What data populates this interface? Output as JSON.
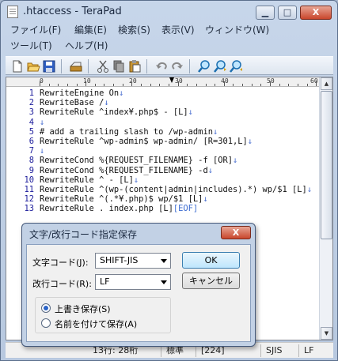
{
  "window": {
    "title": ".htaccess - TeraPad",
    "controls": {
      "minimize": "▁",
      "maximize": "□",
      "close": "X"
    }
  },
  "menu": [
    {
      "label": "ファイル(F)"
    },
    {
      "label": "編集(E)"
    },
    {
      "label": "検索(S)"
    },
    {
      "label": "表示(V)"
    },
    {
      "label": "ウィンドウ(W)"
    },
    {
      "label": "ツール(T)"
    },
    {
      "label": "ヘルプ(H)"
    }
  ],
  "toolbar": {
    "buttons": [
      {
        "icon": "new-file-icon"
      },
      {
        "icon": "open-folder-icon"
      },
      {
        "icon": "save-icon"
      },
      {
        "icon": "print-icon"
      },
      {
        "icon": "cut-icon"
      },
      {
        "icon": "copy-icon"
      },
      {
        "icon": "paste-icon"
      },
      {
        "icon": "undo-icon"
      },
      {
        "icon": "redo-icon"
      },
      {
        "icon": "find-icon"
      },
      {
        "icon": "find-next-icon"
      },
      {
        "icon": "find-previous-icon"
      }
    ]
  },
  "ruler": {
    "labels": [
      "0",
      "10",
      "20",
      "30",
      "40",
      "50",
      "60"
    ]
  },
  "editor": {
    "lines": [
      {
        "num": "1",
        "text": "RewriteEngine On",
        "ret": "↓"
      },
      {
        "num": "2",
        "text": "RewriteBase /",
        "ret": "↓"
      },
      {
        "num": "3",
        "text": "RewriteRule ^index¥.php$ - [L]",
        "ret": "↓"
      },
      {
        "num": "4",
        "text": "",
        "ret": "↓"
      },
      {
        "num": "5",
        "text": "# add a trailing slash to /wp-admin",
        "ret": "↓"
      },
      {
        "num": "6",
        "text": "RewriteRule ^wp-admin$ wp-admin/ [R=301,L]",
        "ret": "↓"
      },
      {
        "num": "7",
        "text": "",
        "ret": "↓"
      },
      {
        "num": "8",
        "text": "RewriteCond %{REQUEST_FILENAME} -f [OR]",
        "ret": "↓"
      },
      {
        "num": "9",
        "text": "RewriteCond %{REQUEST_FILENAME} -d",
        "ret": "↓"
      },
      {
        "num": "10",
        "text": "RewriteRule ^ - [L]",
        "ret": "↓"
      },
      {
        "num": "11",
        "text": "RewriteRule ^(wp-(content|admin|includes).*) wp/$1 [L]",
        "ret": "↓"
      },
      {
        "num": "12",
        "text": "RewriteRule ^(.*¥.php)$ wp/$1 [L]",
        "ret": "↓"
      },
      {
        "num": "13",
        "text": "RewriteRule . index.php [L]",
        "ret": "[EOF]"
      }
    ]
  },
  "status": {
    "position": "13行:  28桁",
    "mode": "標準",
    "count": "[224]",
    "encoding": "SJIS",
    "linebreak": "LF"
  },
  "dialog": {
    "title": "文字/改行コード指定保存",
    "close": "X",
    "charset_label": "文字コード(J):",
    "charset_value": "SHIFT-JIS",
    "linebreak_label": "改行コード(R):",
    "linebreak_value": "LF",
    "ok_label": "OK",
    "cancel_label": "キャンセル",
    "options": [
      {
        "label": "上書き保存(S)",
        "selected": true
      },
      {
        "label": "名前を付けて保存(A)",
        "selected": false
      }
    ]
  }
}
